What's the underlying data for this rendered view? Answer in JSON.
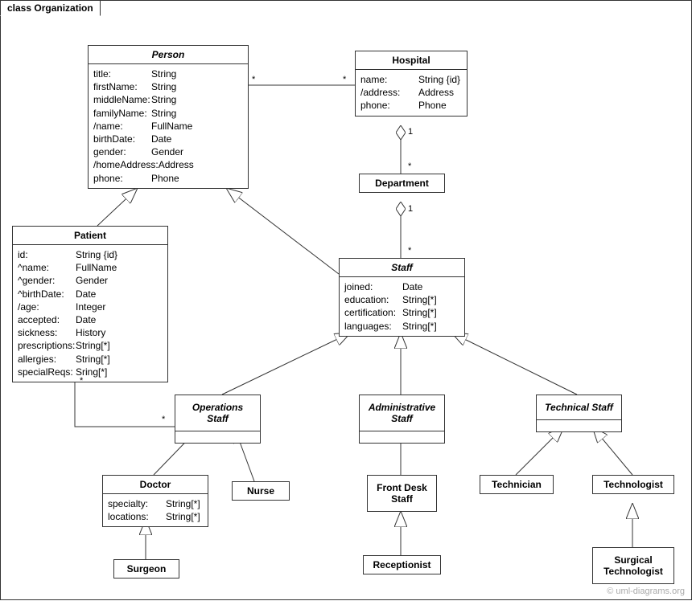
{
  "frame": {
    "title": "class Organization"
  },
  "classes": {
    "person": {
      "name": "Person",
      "attrs": [
        {
          "name": "title:",
          "type": "String"
        },
        {
          "name": "firstName:",
          "type": "String"
        },
        {
          "name": "middleName:",
          "type": "String"
        },
        {
          "name": "familyName:",
          "type": "String"
        },
        {
          "name": "/name:",
          "type": "FullName"
        },
        {
          "name": "birthDate:",
          "type": "Date"
        },
        {
          "name": "gender:",
          "type": "Gender"
        },
        {
          "name": "/homeAddress:",
          "type": "Address"
        },
        {
          "name": "phone:",
          "type": "Phone"
        }
      ]
    },
    "hospital": {
      "name": "Hospital",
      "attrs": [
        {
          "name": "name:",
          "type": "String {id}"
        },
        {
          "name": "/address:",
          "type": "Address"
        },
        {
          "name": "phone:",
          "type": "Phone"
        }
      ]
    },
    "department": {
      "name": "Department"
    },
    "staff": {
      "name": "Staff",
      "attrs": [
        {
          "name": "joined:",
          "type": "Date"
        },
        {
          "name": "education:",
          "type": "String[*]"
        },
        {
          "name": "certification:",
          "type": "String[*]"
        },
        {
          "name": "languages:",
          "type": "String[*]"
        }
      ]
    },
    "patient": {
      "name": "Patient",
      "attrs": [
        {
          "name": "id:",
          "type": "String {id}"
        },
        {
          "name": "^name:",
          "type": "FullName"
        },
        {
          "name": "^gender:",
          "type": "Gender"
        },
        {
          "name": "^birthDate:",
          "type": "Date"
        },
        {
          "name": "/age:",
          "type": "Integer"
        },
        {
          "name": "accepted:",
          "type": "Date"
        },
        {
          "name": "sickness:",
          "type": "History"
        },
        {
          "name": "prescriptions:",
          "type": "String[*]"
        },
        {
          "name": "allergies:",
          "type": "String[*]"
        },
        {
          "name": "specialReqs:",
          "type": "Sring[*]"
        }
      ]
    },
    "opstaff": {
      "name": "Operations Staff"
    },
    "adminstaff": {
      "name": "Administrative Staff"
    },
    "techstaff": {
      "name": "Technical Staff"
    },
    "doctor": {
      "name": "Doctor",
      "attrs": [
        {
          "name": "specialty:",
          "type": "String[*]"
        },
        {
          "name": "locations:",
          "type": "String[*]"
        }
      ]
    },
    "nurse": {
      "name": "Nurse"
    },
    "frontdesk": {
      "name": "Front Desk Staff"
    },
    "receptionist": {
      "name": "Receptionist"
    },
    "technician": {
      "name": "Technician"
    },
    "technologist": {
      "name": "Technologist"
    },
    "surgtech": {
      "name": "Surgical Technologist"
    },
    "surgeon": {
      "name": "Surgeon"
    }
  },
  "mult": {
    "person_hosp_left": "*",
    "person_hosp_right": "*",
    "hosp_dept": "1",
    "dept_top": "*",
    "dept_staff": "1",
    "staff_top": "*",
    "patient_ops_p": "*",
    "patient_ops_o": "*"
  },
  "watermark": "© uml-diagrams.org"
}
